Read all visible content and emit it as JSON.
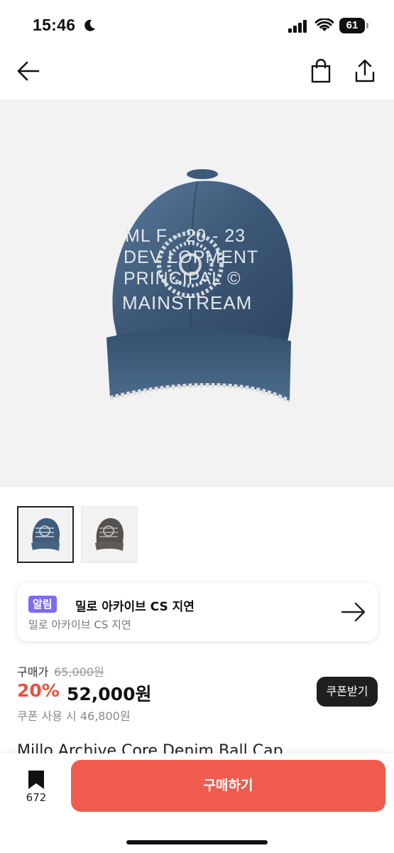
{
  "status_bar": {
    "time": "15:46",
    "battery": "61"
  },
  "nav": {
    "back_icon": "arrow-left-icon",
    "cart_icon": "shopping-bag-icon",
    "share_icon": "share-icon"
  },
  "product_image": {
    "cap_lines": [
      "ML F · 20 - 23",
      "DEV LOPMENT",
      "PRINCIPAL ©",
      "MAINSTREAM"
    ]
  },
  "thumbnails": [
    {
      "variant": "blue denim",
      "selected": true
    },
    {
      "variant": "black denim",
      "selected": false
    }
  ],
  "notice": {
    "badge": "알림",
    "title": "밀로 아카이브 CS 지연",
    "subtitle": "밀로 아카이브 CS 지연",
    "arrow_icon": "arrow-right-icon"
  },
  "price": {
    "label": "구매가",
    "original": "65,000원",
    "discount": "20%",
    "sale": "52,000원",
    "coupon_text": "쿠폰 사용 시 46,800원",
    "coupon_button": "쿠폰받기"
  },
  "product_name": "Millo Archive Core Denim Ball Cap",
  "bottom_bar": {
    "bookmark_icon": "bookmark-icon",
    "bookmark_count": "672",
    "buy_button": "구매하기"
  },
  "colors": {
    "accent": "#ef5c4f",
    "discount": "#e8513f",
    "badge": "#7b6cf6"
  }
}
